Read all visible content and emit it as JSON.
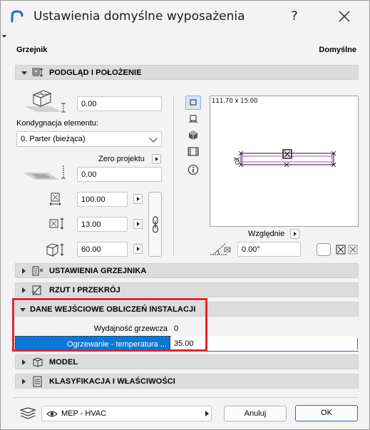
{
  "window": {
    "title": "Ustawienia domyślne wyposażenia",
    "help_glyph": "?",
    "close_glyph": "✕"
  },
  "header": {
    "left_label": "Grzejnik",
    "right_label": "Domyślne"
  },
  "sections": {
    "preview_position": "PODGLĄD I POŁOŻENIE",
    "radiator_settings": "USTAWIENIA GRZEJNIKA",
    "plan_section": "RZUT I PRZEKRÓJ",
    "mep_input": "DANE WEJŚCIOWE OBLICZEŃ INSTALACJI",
    "model": "MODEL",
    "classification": "KLASYFIKACJA I WŁAŚCIWOŚCI"
  },
  "position": {
    "top_offset": "0.00",
    "story_label": "Kondygnacja elementu:",
    "story_value": "0. Parter (bieżąca)",
    "zero_label": "Zero projektu",
    "elevation": "0.00",
    "width": "100.00",
    "depth": "13.00",
    "height": "60.00",
    "relative_label": "Względnie",
    "rotation": "0.00°"
  },
  "preview": {
    "dimensions": "111.70 x 15.00"
  },
  "mep_table": {
    "rows": [
      {
        "name": "Wydajność grzewcza",
        "value": "0"
      },
      {
        "name": "Ogrzewanie - temperatura ...",
        "value": "35.00"
      }
    ]
  },
  "footer": {
    "layer_value": "MEP - HVAC",
    "cancel_label": "Anuluj",
    "ok_label": "OK"
  },
  "colors": {
    "accent": "#0078d7",
    "selection": "#0a78d4",
    "highlight": "#e0242a",
    "preview_object": "#7b2a8a"
  }
}
